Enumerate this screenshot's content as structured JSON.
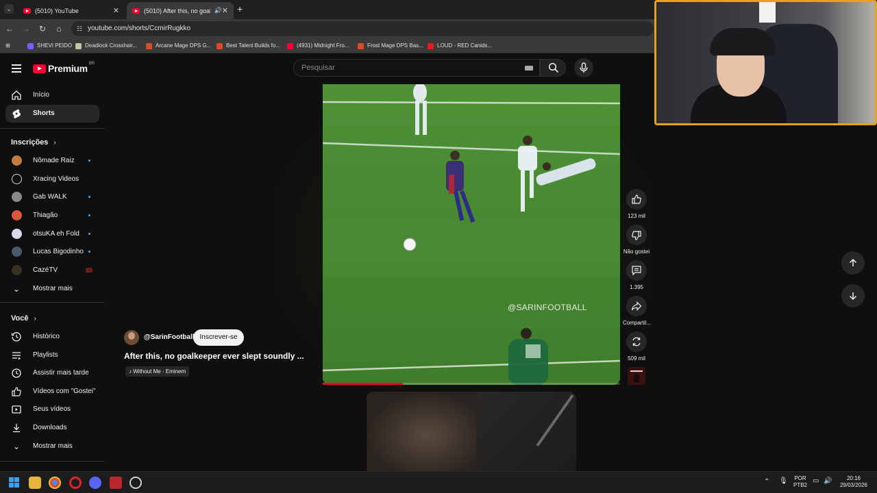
{
  "browser": {
    "tabs": [
      {
        "title": "(5010) YouTube",
        "active": false
      },
      {
        "title": "(5010) After this, no goalke",
        "active": true
      }
    ],
    "url": "youtube.com/shorts/CcmirRugkko",
    "bookmarks": [
      {
        "label": "SHEVI PEIDO",
        "icon_color": "#7b5cff"
      },
      {
        "label": "Deadlock Crosshair...",
        "icon_color": "#c9c3a0"
      },
      {
        "label": "Arcane Mage DPS G...",
        "icon_color": "#d64b2c"
      },
      {
        "label": "Best Talent Builds fo...",
        "icon_color": "#d64b2c"
      },
      {
        "label": "(4931) Midnight Fro...",
        "icon_color": "#ff0033"
      },
      {
        "label": "Frost Mage DPS Bas...",
        "icon_color": "#d64b2c"
      },
      {
        "label": "LOUD - RED Canids...",
        "icon_color": "#e02020"
      }
    ]
  },
  "header": {
    "logo_text": "Premium",
    "logo_country": "BR",
    "search_placeholder": "Pesquisar"
  },
  "sidebar": {
    "main": [
      {
        "label": "Início",
        "icon": "home-icon",
        "active": false
      },
      {
        "label": "Shorts",
        "icon": "shorts-icon",
        "active": true
      }
    ],
    "subs_heading": "Inscrições",
    "subscriptions": [
      {
        "label": "Nômade Raiz",
        "avatar_color": "#c07a42",
        "status": "new"
      },
      {
        "label": "Xracing Videos",
        "avatar_color": "#dcdcdc",
        "status": "none"
      },
      {
        "label": "Gab WALK",
        "avatar_color": "#8a8a8a",
        "status": "new"
      },
      {
        "label": "Thiagão",
        "avatar_color": "#d9573a",
        "status": "new"
      },
      {
        "label": "otsuKA eh Fold",
        "avatar_color": "#d8d8e8",
        "status": "new"
      },
      {
        "label": "Lucas Bigodinho",
        "avatar_color": "#4b5a6a",
        "status": "new"
      },
      {
        "label": "CazéTV",
        "avatar_color": "#3a3020",
        "status": "live"
      }
    ],
    "subs_more": "Mostrar mais",
    "you_heading": "Você",
    "you": [
      {
        "label": "Histórico",
        "icon": "history-icon"
      },
      {
        "label": "Playlists",
        "icon": "playlists-icon"
      },
      {
        "label": "Assistir mais tarde",
        "icon": "watch-later-icon"
      },
      {
        "label": "Vídeos com \"Gostei\"",
        "icon": "liked-icon"
      },
      {
        "label": "Seus vídeos",
        "icon": "your-videos-icon"
      },
      {
        "label": "Downloads",
        "icon": "downloads-icon"
      }
    ],
    "you_more": "Mostrar mais"
  },
  "short": {
    "watermark": "@SARINFOOTBALL",
    "channel": "@SarinFootball",
    "subscribe": "Inscrever-se",
    "title": "After this, no goalkeeper ever slept soundly ...",
    "music": "Without Me · Eminem",
    "progress": 0.27,
    "actions": [
      {
        "name": "like",
        "label": "123 mil"
      },
      {
        "name": "dislike",
        "label": "Não gostei"
      },
      {
        "name": "comments",
        "label": "1.395"
      },
      {
        "name": "share",
        "label": "Compartil..."
      },
      {
        "name": "remix",
        "label": "509 mil"
      }
    ]
  },
  "taskbar": {
    "lang": "POR",
    "layout": "PTB2",
    "time": "20:16",
    "date": "29/03/2026"
  }
}
